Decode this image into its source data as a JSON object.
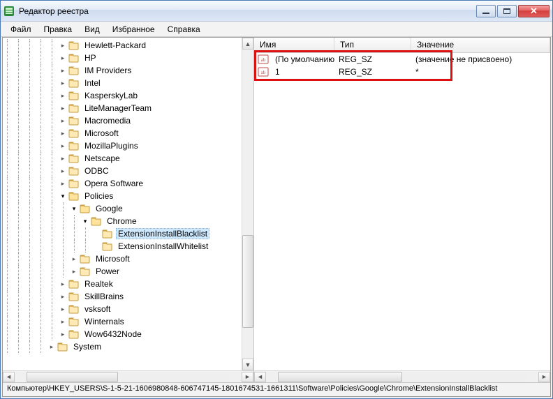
{
  "window": {
    "title": "Редактор реестра"
  },
  "menu": {
    "file": "Файл",
    "edit": "Правка",
    "view": "Вид",
    "favorites": "Избранное",
    "help": "Справка"
  },
  "tree": [
    {
      "indent": 5,
      "exp": "closed",
      "label": "Hewlett-Packard"
    },
    {
      "indent": 5,
      "exp": "closed",
      "label": "HP"
    },
    {
      "indent": 5,
      "exp": "closed",
      "label": "IM Providers"
    },
    {
      "indent": 5,
      "exp": "closed",
      "label": "Intel"
    },
    {
      "indent": 5,
      "exp": "closed",
      "label": "KasperskyLab"
    },
    {
      "indent": 5,
      "exp": "closed",
      "label": "LiteManagerTeam"
    },
    {
      "indent": 5,
      "exp": "closed",
      "label": "Macromedia"
    },
    {
      "indent": 5,
      "exp": "closed",
      "label": "Microsoft"
    },
    {
      "indent": 5,
      "exp": "closed",
      "label": "MozillaPlugins"
    },
    {
      "indent": 5,
      "exp": "closed",
      "label": "Netscape"
    },
    {
      "indent": 5,
      "exp": "closed",
      "label": "ODBC"
    },
    {
      "indent": 5,
      "exp": "closed",
      "label": "Opera Software"
    },
    {
      "indent": 5,
      "exp": "open",
      "label": "Policies"
    },
    {
      "indent": 6,
      "exp": "open",
      "label": "Google"
    },
    {
      "indent": 7,
      "exp": "open",
      "label": "Chrome"
    },
    {
      "indent": 8,
      "exp": "none",
      "label": "ExtensionInstallBlacklist",
      "selected": true
    },
    {
      "indent": 8,
      "exp": "none",
      "label": "ExtensionInstallWhitelist"
    },
    {
      "indent": 6,
      "exp": "closed",
      "label": "Microsoft"
    },
    {
      "indent": 6,
      "exp": "closed",
      "label": "Power"
    },
    {
      "indent": 5,
      "exp": "closed",
      "label": "Realtek"
    },
    {
      "indent": 5,
      "exp": "closed",
      "label": "SkillBrains"
    },
    {
      "indent": 5,
      "exp": "closed",
      "label": "vsksoft"
    },
    {
      "indent": 5,
      "exp": "closed",
      "label": "Winternals"
    },
    {
      "indent": 5,
      "exp": "closed",
      "label": "Wow6432Node"
    },
    {
      "indent": 4,
      "exp": "closed",
      "label": "System"
    }
  ],
  "list": {
    "headers": {
      "name": "Имя",
      "type": "Тип",
      "value": "Значение"
    },
    "rows": [
      {
        "name": "(По умолчанию)",
        "type": "REG_SZ",
        "value": "(значение не присвоено)"
      },
      {
        "name": "1",
        "type": "REG_SZ",
        "value": "*"
      }
    ]
  },
  "status": "Компьютер\\HKEY_USERS\\S-1-5-21-1606980848-606747145-1801674531-1661311\\Software\\Policies\\Google\\Chrome\\ExtensionInstallBlacklist"
}
